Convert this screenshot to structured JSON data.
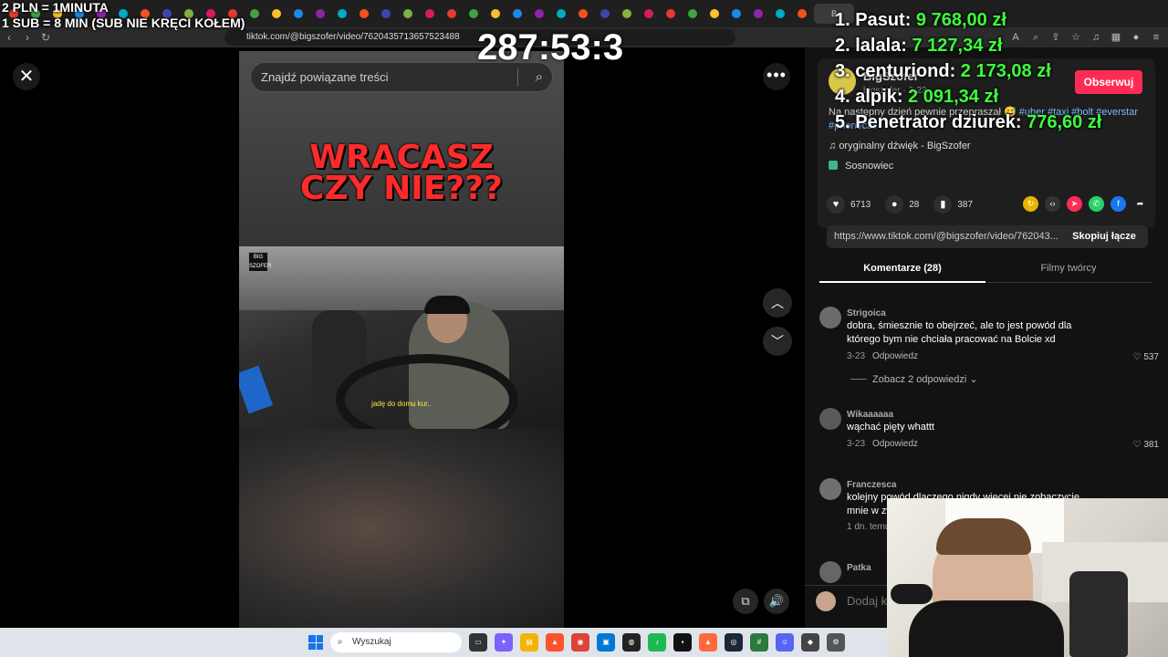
{
  "browser": {
    "url": "tiktok.com/@bigszofer/video/7620435713657523488",
    "tabs": [
      "",
      "",
      "",
      "",
      "",
      "",
      "",
      "",
      "",
      "",
      "",
      "",
      "",
      "",
      "",
      "",
      "",
      "",
      "",
      "",
      "",
      "",
      "",
      "",
      "",
      "",
      "",
      "",
      "",
      "",
      "",
      "",
      "",
      "",
      "",
      "",
      ""
    ],
    "active_tab_label": "B"
  },
  "overlay": {
    "rate_line1": "2 PLN =  1MINUTA",
    "rate_line2": "1 SUB = 8 MIN (SUB NIE KRĘCI KOŁEM)",
    "timer": "287:53:3",
    "leaderboard": [
      {
        "rank_name": "1. Pasut:",
        "amount": "9 768,00 zł"
      },
      {
        "rank_name": "2. lalala:",
        "amount": "7 127,34 zł"
      },
      {
        "rank_name": "3. centuriond:",
        "amount": "2 173,08 zł"
      },
      {
        "rank_name": "4. alpik:",
        "amount": "2 091,34 zł"
      },
      {
        "rank_name": "5. Penetrator dziurek:",
        "amount": "776,60 zł"
      }
    ]
  },
  "player": {
    "search_placeholder": "Znajdź powiązane treści",
    "video_title_line1": "WRACASZ",
    "video_title_line2": "CZY NIE???",
    "badge_text": "BIG SZOFER",
    "subtitle": "jadę do domu kur..",
    "close_glyph": "✕",
    "more_glyph": "•••",
    "up_glyph": "︿",
    "down_glyph": "﹀"
  },
  "author": {
    "name": "BigSzofer",
    "sub": "bigszofer · 3-23",
    "follow_label": "Obserwuj",
    "description": "Na następny dzień pewnie przepraszał 😅",
    "tags": "#uber #taxi #bolt #everstar #phonecall",
    "sound": "oryginalny dźwięk - BigSzofer",
    "location": "Sosnowiec"
  },
  "stats": {
    "likes": "6713",
    "comments": "28",
    "saves": "387"
  },
  "share": {
    "link": "https://www.tiktok.com/@bigszofer/video/762043...",
    "copy_label": "Skopiuj łącze"
  },
  "tabs": {
    "comments": "Komentarze (28)",
    "creator_videos": "Filmy twórcy"
  },
  "comments": [
    {
      "user": "Strigoica",
      "text": "dobra, śmiesznie to obejrzeć, ale to jest powód dla którego bym nie chciała pracować na Bolcie xd",
      "date": "3-23",
      "reply": "Odpowiedz",
      "likes": "537"
    },
    {
      "user": "Wikaaaaaa",
      "text": "wąchać pięty whattt",
      "date": "3-23",
      "reply": "Odpowiedz",
      "likes": "381"
    },
    {
      "user": "Franczesca",
      "text": "kolejny powód dlaczego nigdy więcej nie zobaczycie mnie w związku",
      "date": "1 dn. temu",
      "reply": "",
      "likes": ""
    },
    {
      "user": "Patka",
      "text": "",
      "date": "",
      "reply": "",
      "likes": ""
    }
  ],
  "more_replies": "Zobacz 2 odpowiedzi",
  "comment_input_placeholder": "Dodaj k",
  "taskbar": {
    "search_label": "Wyszukaj"
  }
}
